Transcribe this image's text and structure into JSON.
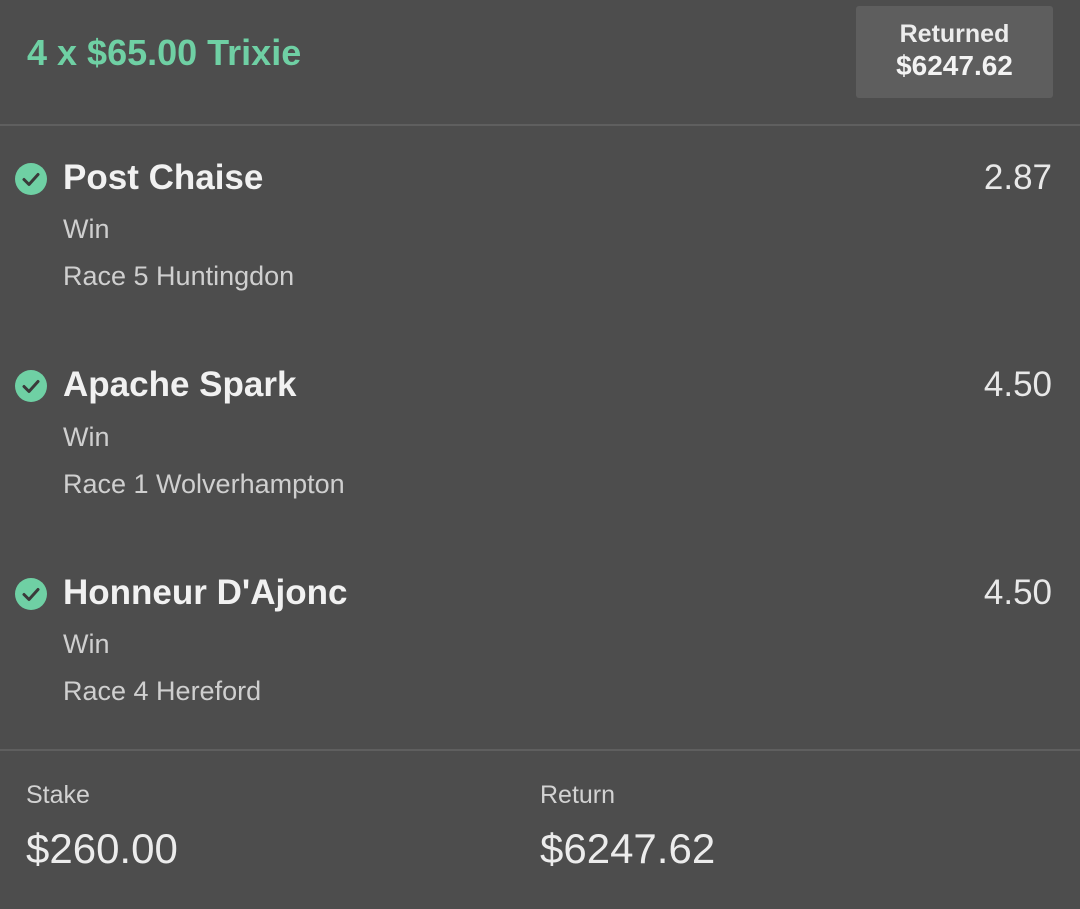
{
  "bet": {
    "title": "4 x $65.00 Trixie",
    "returned_label": "Returned",
    "returned_amount": "$6247.62"
  },
  "selections": [
    {
      "name": "Post Chaise",
      "odds": "2.87",
      "market": "Win",
      "event": "Race 5 Huntingdon",
      "status_icon": "check-circle-icon"
    },
    {
      "name": "Apache Spark",
      "odds": "4.50",
      "market": "Win",
      "event": "Race 1 Wolverhampton",
      "status_icon": "check-circle-icon"
    },
    {
      "name": "Honneur D'Ajonc",
      "odds": "4.50",
      "market": "Win",
      "event": "Race 4 Hereford",
      "status_icon": "check-circle-icon"
    }
  ],
  "summary": {
    "stake_label": "Stake",
    "stake_value": "$260.00",
    "return_label": "Return",
    "return_value": "$6247.62"
  },
  "colors": {
    "background": "#4d4d4d",
    "accent_green": "#6fd0a4",
    "badge_background": "#5e5e5e",
    "divider": "#5f5f5f"
  }
}
